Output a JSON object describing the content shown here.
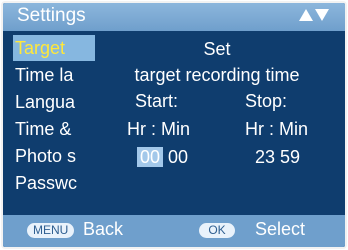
{
  "header": {
    "title": "Settings",
    "arrows_icon": "up-down-arrows-icon"
  },
  "menu": {
    "items": [
      {
        "label": "Target"
      },
      {
        "label": "Time la"
      },
      {
        "label": "Langua"
      },
      {
        "label": "Time &"
      },
      {
        "label": "Photo s"
      },
      {
        "label": "Passwc"
      }
    ],
    "selected_index": 0
  },
  "detail": {
    "heading": "Set",
    "subheading": "target recording time",
    "start_label": "Start:",
    "stop_label": "Stop:",
    "start_format": "Hr : Min",
    "stop_format": "Hr : Min",
    "start_hour": "00",
    "start_min": "00",
    "stop_hour": "23",
    "stop_min": "59"
  },
  "footer": {
    "menu_key": "MENU",
    "back_label": "Back",
    "ok_key": "OK",
    "select_label": "Select"
  },
  "colors": {
    "background": "#0f3d6e",
    "header": "#8cb6dc",
    "selected_text": "#ffe83a",
    "highlight": "#a3c8ea"
  }
}
